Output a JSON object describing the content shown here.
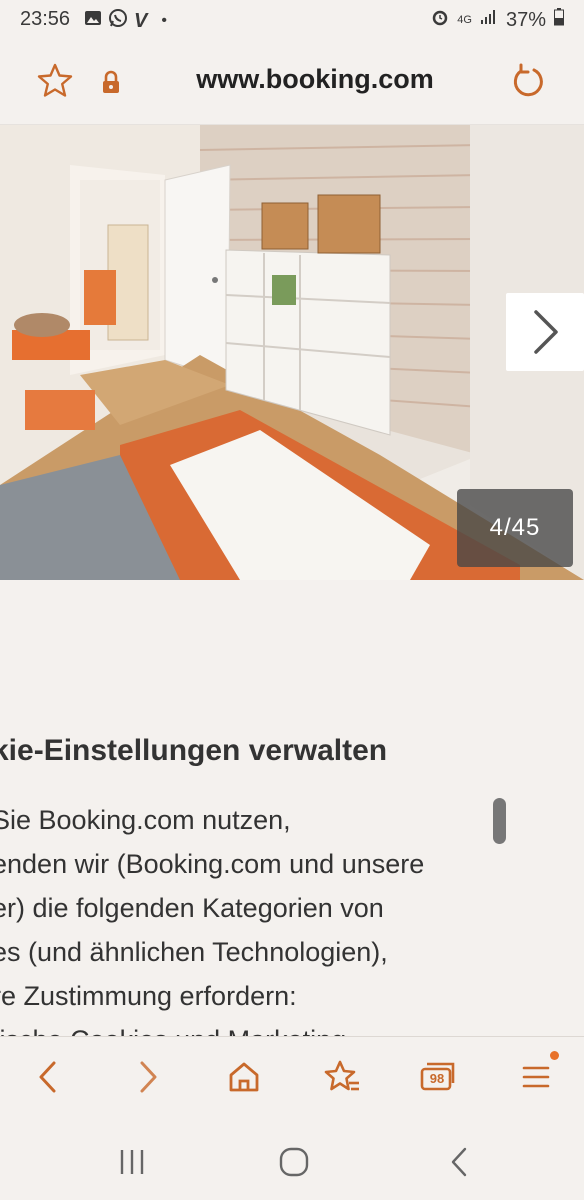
{
  "status_bar": {
    "time": "23:56",
    "left_icons": [
      "gallery-icon",
      "whatsapp-icon",
      "v-icon",
      "dot-icon"
    ],
    "network": "4G",
    "battery": "37%"
  },
  "url_bar": {
    "url": "www.booking.com"
  },
  "gallery": {
    "counter": "4/45"
  },
  "cookie_notice": {
    "heading": "kie-Einstellungen verwalten",
    "lines": [
      " Sie Booking.com nutzen,",
      "enden wir (Booking.com und unsere",
      "er) die folgenden Kategorien von",
      "es (und ähnlichen Technologien),",
      "re Zustimmung erfordern:",
      "tische Cookies und Marketing"
    ]
  },
  "toolbar": {
    "tabs_count": "98"
  },
  "colors": {
    "accent": "#c8692b",
    "background": "#f4f1ee"
  }
}
